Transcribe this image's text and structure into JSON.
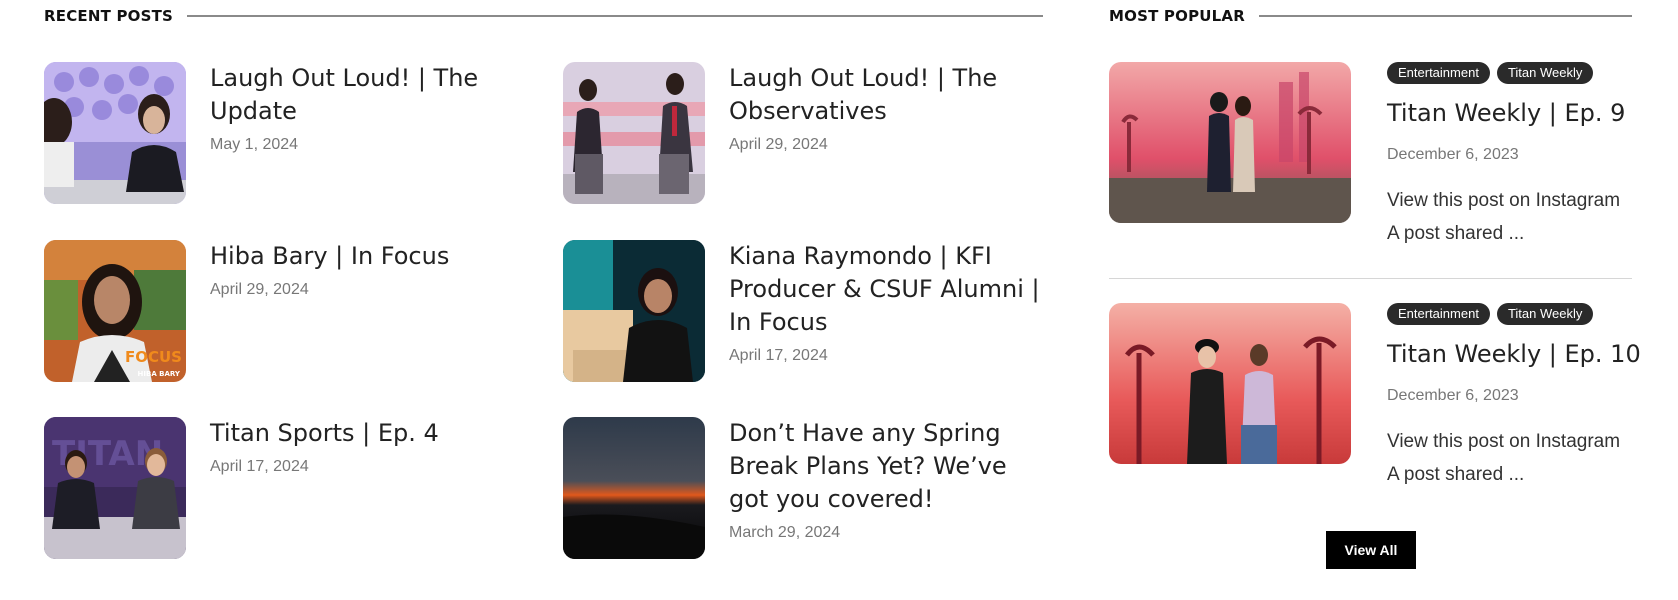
{
  "recent": {
    "heading": "RECENT POSTS",
    "posts": [
      {
        "title": "Laugh Out Loud! | The Update",
        "date": "May 1, 2024",
        "icon": "news-desk-thumbnail"
      },
      {
        "title": "Laugh Out Loud! | The Observatives",
        "date": "April 29, 2024",
        "icon": "podium-thumbnail"
      },
      {
        "title": "Hiba Bary | In Focus",
        "date": "April 29, 2024",
        "icon": "portrait-thumbnail"
      },
      {
        "title": "Kiana Raymondo | KFI Producer & CSUF Alumni | In Focus",
        "date": "April 17, 2024",
        "icon": "interview-thumbnail"
      },
      {
        "title": "Titan Sports | Ep. 4",
        "date": "April 17, 2024",
        "icon": "sports-desk-thumbnail"
      },
      {
        "title": "Don’t Have any Spring Break Plans Yet? We’ve got you covered!",
        "date": "March 29, 2024",
        "icon": "sunset-beach-thumbnail"
      }
    ]
  },
  "popular": {
    "heading": "MOST POPULAR",
    "posts": [
      {
        "tags": [
          "Entertainment",
          "Titan Weekly"
        ],
        "title": "Titan Weekly | Ep. 9",
        "date": "December 6, 2023",
        "excerpt_line1": "View this post on Instagram",
        "excerpt_line2": "A post shared ..."
      },
      {
        "tags": [
          "Entertainment",
          "Titan Weekly"
        ],
        "title": "Titan Weekly | Ep. 10",
        "date": "December 6, 2023",
        "excerpt_line1": "View this post on Instagram",
        "excerpt_line2": "A post shared ..."
      }
    ],
    "view_all_label": "View All"
  },
  "thumb_overlay": {
    "focus_text": "FOCUS",
    "name_text": "HIBA BARY"
  },
  "colors": {
    "accent": "#000000",
    "tag_bg": "#2a2a2a",
    "date": "#777777"
  }
}
